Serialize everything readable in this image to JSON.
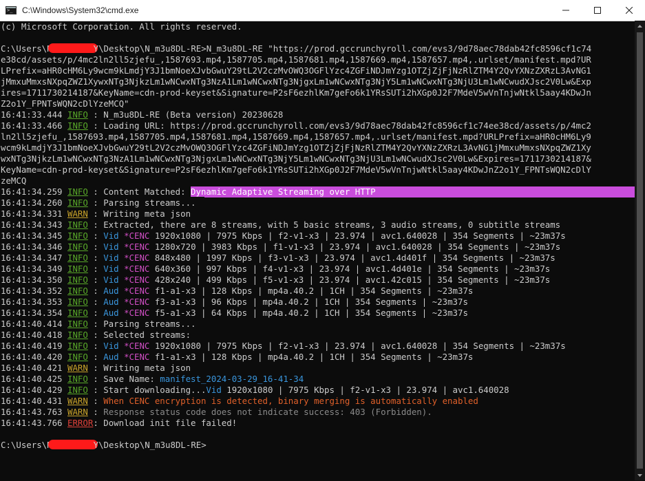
{
  "window": {
    "title": "C:\\Windows\\System32\\cmd.exe",
    "minimize_icon": "minimize-icon",
    "maximize_icon": "maximize-icon",
    "close_icon": "close-icon"
  },
  "colors": {
    "background": "#0c0c0c",
    "info": "#59a829",
    "warn": "#c9a32a",
    "error": "#e0413a",
    "highlight": "#c94ddc",
    "redaction": "#ff1a1a"
  },
  "console": {
    "copyright": "(c) Microsoft Corporation. All rights reserved.",
    "prompt_prefix": "C:\\Users\\N",
    "prompt_suffix_1": "Y\\Desktop\\N_m3u8DL-RE>N_m3u8DL-RE \"https://prod.gccrunchyroll.com/evs3/9d78aec78dab42fc8596cf1c74",
    "cmd_cont": [
      "e38cd/assets/p/4mc2ln2ll5zjefu_,1587693.mp4,1587705.mp4,1587681.mp4,1587669.mp4,1587657.mp4,.urlset/manifest.mpd?UR",
      "LPrefix=aHR0cHM6Ly9wcm9kLmdjY3J1bmNoeXJvbGwuY29tL2V2czMvOWQ3OGFlYzc4ZGFiNDJmYzg1OTZjZjFjNzRlZTM4Y2QvYXNzZXRzL3AvNG1",
      "jMmxuMmxsNXpqZWZ1XywxNTg3NjkzLm1wNCwxNTg3NzA1Lm1wNCwxNTg3NjgxLm1wNCwxNTg3NjY5Lm1wNCwxNTg3NjU3Lm1wNCwudXJsc2V0Lw&Exp",
      "ires=1711730214187&KeyName=cdn-prod-keyset&Signature=P2sF6ezhlKm7geFo6k1YRsSUTi2hXGp0J2F7MdeV5wVnTnjwNtkl5aay4KDwJn",
      "Z2o1Y_FPNTsWQN2cDlYzeMCQ\""
    ],
    "log": [
      {
        "t": "16:41:33.444",
        "lvl": "INFO",
        "msg": "N_m3u8DL-RE (Beta version) 20230628"
      },
      {
        "t": "16:41:33.466",
        "lvl": "INFO",
        "msg": "Loading URL: https://prod.gccrunchyroll.com/evs3/9d78aec78dab42fc8596cf1c74ee38cd/assets/p/4mc2"
      },
      {
        "t": "",
        "lvl": "",
        "msg": "ln2ll5zjefu_,1587693.mp4,1587705.mp4,1587681.mp4,1587669.mp4,1587657.mp4,.urlset/manifest.mpd?URLPrefix=aHR0cHM6Ly9"
      },
      {
        "t": "",
        "lvl": "",
        "msg": "wcm9kLmdjY3J1bmNoeXJvbGwuY29tL2V2czMvOWQ3OGFlYzc4ZGFiNDJmYzg1OTZjZjFjNzRlZTM4Y2QvYXNzZXRzL3AvNG1jMmxuMmxsNXpqZWZ1Xy"
      },
      {
        "t": "",
        "lvl": "",
        "msg": "wxNTg3NjkzLm1wNCwxNTg3NzA1Lm1wNCwxNTg3NjgxLm1wNCwxNTg3NjY5Lm1wNCwxNTg3NjU3Lm1wNCwudXJsc2V0Lw&Expires=1711730214187&"
      },
      {
        "t": "",
        "lvl": "",
        "msg": "KeyName=cdn-prod-keyset&Signature=P2sF6ezhlKm7geFo6k1YRsSUTi2hXGp0J2F7MdeV5wVnTnjwNtkl5aay4KDwJnZ2o1Y_FPNTsWQN2cDlY"
      },
      {
        "t": "",
        "lvl": "",
        "msg": "zeMCQ"
      }
    ],
    "content_matched_prefix": "16:41:34.259 ",
    "content_matched_label": " : Content Matched: ",
    "content_matched_value": "Dynamic Adaptive Streaming over HTTP",
    "lines": [
      {
        "t": "16:41:34.260",
        "lvl": "INFO",
        "msg": " : Parsing streams..."
      },
      {
        "t": "16:41:34.331",
        "lvl": "WARN",
        "msg": " : Writing meta json"
      },
      {
        "t": "16:41:34.343",
        "lvl": "INFO",
        "msg": " : Extracted, there are 8 streams, with 5 basic streams, 3 audio streams, 0 subtitle streams"
      }
    ],
    "streams": [
      {
        "t": "16:41:34.345",
        "kind": "Vid",
        "rest": " 1920x1080 | 7975 Kbps | f2-v1-x3 | 23.974 | avc1.640028 | 354 Segments | ~23m37s"
      },
      {
        "t": "16:41:34.346",
        "kind": "Vid",
        "rest": " 1280x720 | 3983 Kbps | f1-v1-x3 | 23.974 | avc1.640028 | 354 Segments | ~23m37s"
      },
      {
        "t": "16:41:34.347",
        "kind": "Vid",
        "rest": " 848x480 | 1997 Kbps | f3-v1-x3 | 23.974 | avc1.4d401f | 354 Segments | ~23m37s"
      },
      {
        "t": "16:41:34.349",
        "kind": "Vid",
        "rest": " 640x360 | 997 Kbps | f4-v1-x3 | 23.974 | avc1.4d401e | 354 Segments | ~23m37s"
      },
      {
        "t": "16:41:34.350",
        "kind": "Vid",
        "rest": " 428x240 | 499 Kbps | f5-v1-x3 | 23.974 | avc1.42c015 | 354 Segments | ~23m37s"
      },
      {
        "t": "16:41:34.352",
        "kind": "Aud",
        "rest": " f1-a1-x3 | 128 Kbps | mp4a.40.2 | 1CH | 354 Segments | ~23m37s"
      },
      {
        "t": "16:41:34.353",
        "kind": "Aud",
        "rest": " f3-a1-x3 | 96 Kbps | mp4a.40.2 | 1CH | 354 Segments | ~23m37s"
      },
      {
        "t": "16:41:34.354",
        "kind": "Aud",
        "rest": " f5-a1-x3 | 64 Kbps | mp4a.40.2 | 1CH | 354 Segments | ~23m37s"
      }
    ],
    "cenc": "*CENC",
    "parsing2": {
      "t": "16:41:40.414",
      "lvl": "INFO",
      "msg": " : Parsing streams..."
    },
    "selected": {
      "t": "16:41:40.418",
      "lvl": "INFO",
      "msg": " : Selected streams:"
    },
    "selected_streams": [
      {
        "t": "16:41:40.419",
        "kind": "Vid",
        "rest": " 1920x1080 | 7975 Kbps | f2-v1-x3 | 23.974 | avc1.640028 | 354 Segments | ~23m37s"
      },
      {
        "t": "16:41:40.420",
        "kind": "Aud",
        "rest": " f1-a1-x3 | 128 Kbps | mp4a.40.2 | 1CH | 354 Segments | ~23m37s"
      }
    ],
    "writing2": {
      "t": "16:41:40.421",
      "lvl": "WARN",
      "msg": " : Writing meta json"
    },
    "save_name": {
      "t": "16:41:40.425",
      "lvl": "INFO",
      "label": " : Save Name: ",
      "value": "manifest_2024-03-29_16-41-34"
    },
    "start_dl": {
      "t": "16:41:40.429",
      "lvl": "INFO",
      "label": " : Start downloading...",
      "vid": "Vid",
      "rest": " 1920x1080 | 7975 Kbps | f2-v1-x3 | 23.974 | avc1.640028"
    },
    "cenc_warn": {
      "t": "16:41:40.431",
      "lvl": "WARN",
      "label": " : ",
      "msg": "When CENC encryption is detected, binary merging is automatically enabled"
    },
    "status_warn": {
      "t": "16:41:43.763",
      "lvl": "WARN",
      "label": " : ",
      "msg": "Response status code does not indicate success: 403 (Forbidden)."
    },
    "error_line": {
      "t": "16:41:43.766",
      "lvl": "ERROR",
      "msg": ": Download init file failed!"
    },
    "final_prompt_suffix": "Y\\Desktop\\N_m3u8DL-RE>"
  }
}
